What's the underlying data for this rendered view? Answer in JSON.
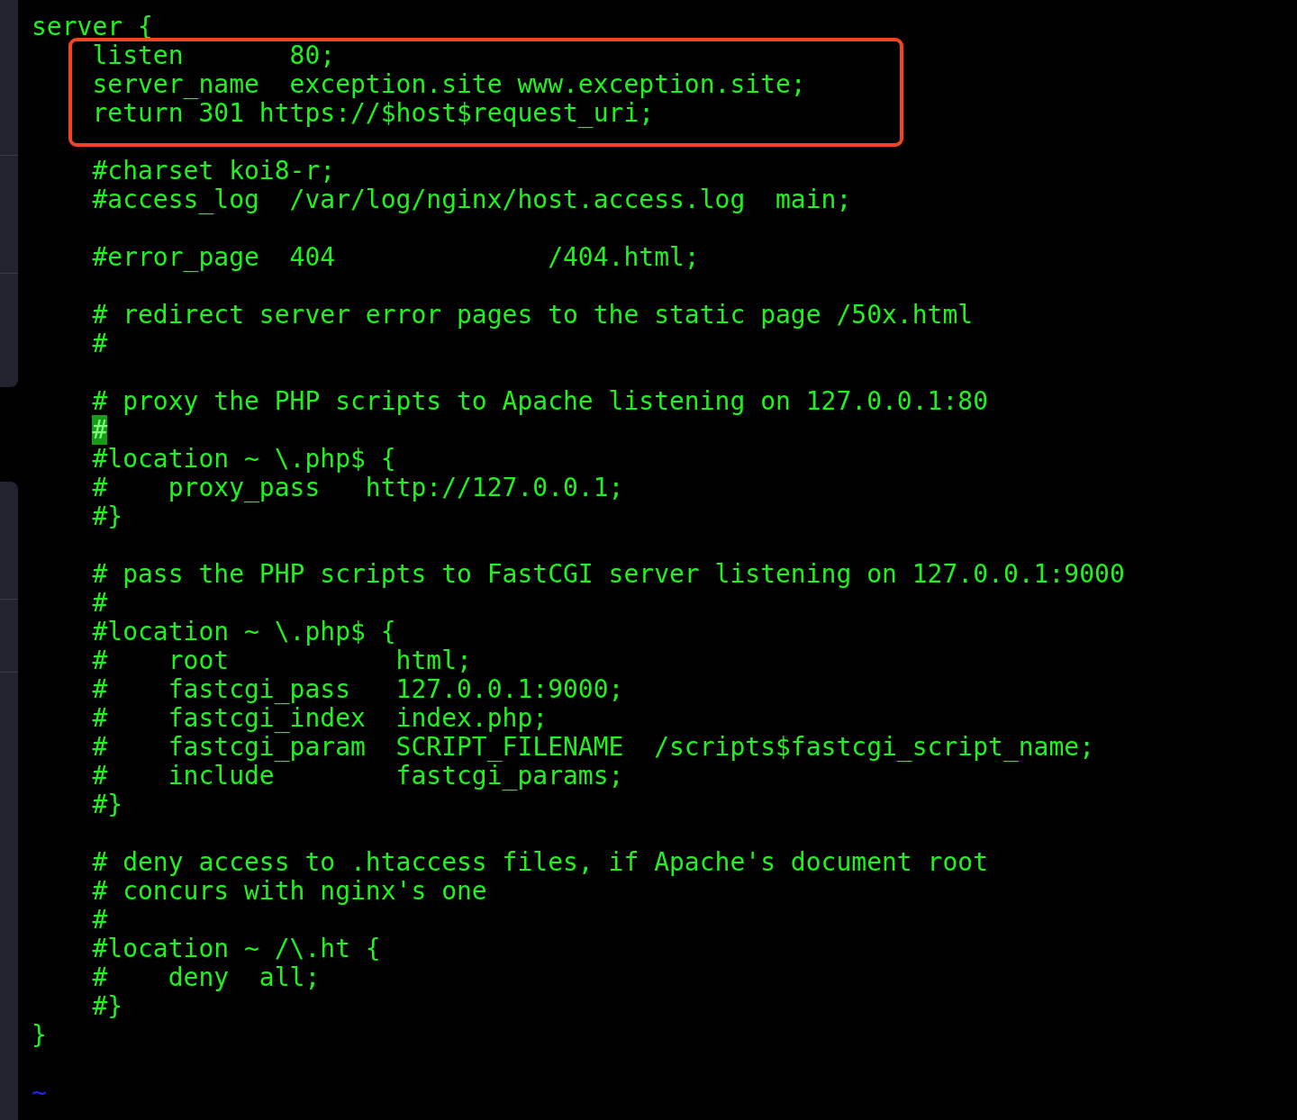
{
  "editor": {
    "lines": [
      {
        "kind": "code",
        "text": "server {",
        "cursor": false
      },
      {
        "kind": "highlight",
        "lines": [
          {
            "kind": "code",
            "text": "    listen       80;",
            "cursor": false
          },
          {
            "kind": "code",
            "text": "    server_name  exception.site www.exception.site;",
            "cursor": false
          },
          {
            "kind": "code",
            "text": "    return 301 https://$host$request_uri;",
            "cursor": false
          }
        ]
      },
      {
        "kind": "blank"
      },
      {
        "kind": "code",
        "text": "    #charset koi8-r;",
        "cursor": false
      },
      {
        "kind": "code",
        "text": "    #access_log  /var/log/nginx/host.access.log  main;",
        "cursor": false
      },
      {
        "kind": "blank"
      },
      {
        "kind": "code",
        "text": "    #error_page  404              /404.html;",
        "cursor": false
      },
      {
        "kind": "blank"
      },
      {
        "kind": "code",
        "text": "    # redirect server error pages to the static page /50x.html",
        "cursor": false
      },
      {
        "kind": "code",
        "text": "    #",
        "cursor": false
      },
      {
        "kind": "blank"
      },
      {
        "kind": "code",
        "text": "    # proxy the PHP scripts to Apache listening on 127.0.0.1:80",
        "cursor": false
      },
      {
        "kind": "code",
        "text": "    #",
        "cursor": true
      },
      {
        "kind": "code",
        "text": "    #location ~ \\.php$ {",
        "cursor": false
      },
      {
        "kind": "code",
        "text": "    #    proxy_pass   http://127.0.0.1;",
        "cursor": false
      },
      {
        "kind": "code",
        "text": "    #}",
        "cursor": false
      },
      {
        "kind": "blank"
      },
      {
        "kind": "code",
        "text": "    # pass the PHP scripts to FastCGI server listening on 127.0.0.1:9000",
        "cursor": false
      },
      {
        "kind": "code",
        "text": "    #",
        "cursor": false
      },
      {
        "kind": "code",
        "text": "    #location ~ \\.php$ {",
        "cursor": false
      },
      {
        "kind": "code",
        "text": "    #    root           html;",
        "cursor": false
      },
      {
        "kind": "code",
        "text": "    #    fastcgi_pass   127.0.0.1:9000;",
        "cursor": false
      },
      {
        "kind": "code",
        "text": "    #    fastcgi_index  index.php;",
        "cursor": false
      },
      {
        "kind": "code",
        "text": "    #    fastcgi_param  SCRIPT_FILENAME  /scripts$fastcgi_script_name;",
        "cursor": false
      },
      {
        "kind": "code",
        "text": "    #    include        fastcgi_params;",
        "cursor": false
      },
      {
        "kind": "code",
        "text": "    #}",
        "cursor": false
      },
      {
        "kind": "blank"
      },
      {
        "kind": "code",
        "text": "    # deny access to .htaccess files, if Apache's document root",
        "cursor": false
      },
      {
        "kind": "code",
        "text": "    # concurs with nginx's one",
        "cursor": false
      },
      {
        "kind": "code",
        "text": "    #",
        "cursor": false
      },
      {
        "kind": "code",
        "text": "    #location ~ /\\.ht {",
        "cursor": false
      },
      {
        "kind": "code",
        "text": "    #    deny  all;",
        "cursor": false
      },
      {
        "kind": "code",
        "text": "    #}",
        "cursor": false
      },
      {
        "kind": "code",
        "text": "}",
        "cursor": false
      },
      {
        "kind": "blank"
      },
      {
        "kind": "tilde",
        "text": "~"
      }
    ]
  }
}
